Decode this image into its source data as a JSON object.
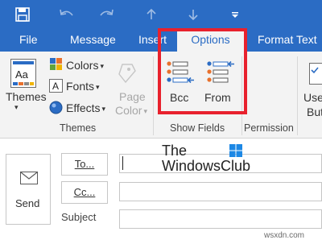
{
  "qat": {
    "save_icon": "save-icon",
    "undo_icon": "undo-icon",
    "redo_icon": "redo-icon",
    "up_icon": "arrow-up-icon",
    "down_icon": "arrow-down-icon",
    "customize_icon": "customize-qat-icon"
  },
  "tabs": [
    "File",
    "Message",
    "Insert",
    "Options",
    "Format Text"
  ],
  "ribbon": {
    "themes": {
      "themes_label": "Themes",
      "colors_label": "Colors",
      "fonts_label": "Fonts",
      "effects_label": "Effects",
      "page_label": "Page",
      "color_label": "Color",
      "group_label": "Themes"
    },
    "show_fields": {
      "bcc_label": "Bcc",
      "from_label": "From",
      "group_label": "Show Fields"
    },
    "permission": {
      "group_label": "Permission"
    },
    "use_buttons": {
      "label_1": "Use",
      "label_2": "But"
    }
  },
  "compose": {
    "send_label": "Send",
    "to_label": "To...",
    "cc_label": "Cc...",
    "subject_label": "Subject",
    "to_value": "",
    "cc_value": "",
    "subject_value": ""
  },
  "watermark": {
    "line1": "The",
    "line2": "WindowsClub",
    "site": "wsxdn.com"
  },
  "colors": {
    "accent": "#2b6cc4",
    "highlight": "#e8212d"
  }
}
